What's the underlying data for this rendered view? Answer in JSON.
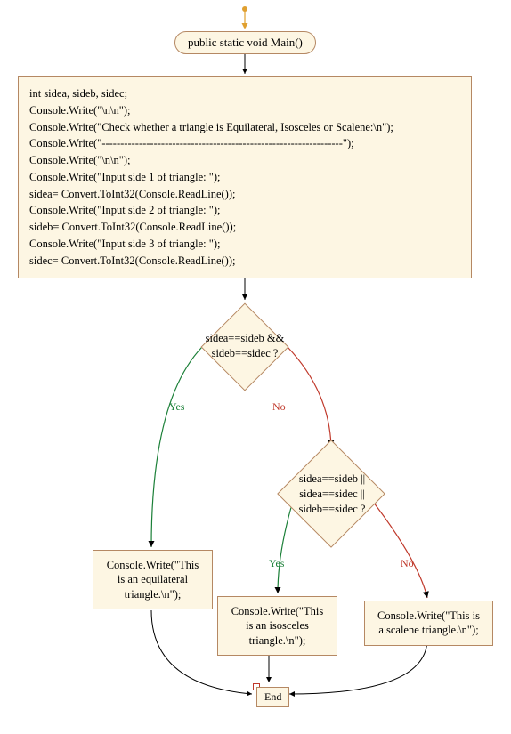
{
  "start": {
    "label": "public static void Main()"
  },
  "code_lines": [
    "int sidea, sideb, sidec;",
    "Console.Write(\"\\n\\n\");",
    "Console.Write(\"Check whether a triangle is Equilateral, Isosceles or Scalene:\\n\");",
    "Console.Write(\"-----------------------------------------------------------------\");",
    "Console.Write(\"\\n\\n\");",
    "Console.Write(\"Input side 1 of triangle: \");",
    "sidea= Convert.ToInt32(Console.ReadLine());",
    "Console.Write(\"Input side 2 of triangle: \");",
    "sideb= Convert.ToInt32(Console.ReadLine());",
    "Console.Write(\"Input side 3 of triangle: \");",
    "sidec= Convert.ToInt32(Console.ReadLine());"
  ],
  "decision1_lines": [
    "sidea==sideb &&",
    "sideb==sidec ?"
  ],
  "decision2_lines": [
    "sidea==sideb ||",
    "sidea==sidec ||",
    "sideb==sidec ?"
  ],
  "out_equilateral": "Console.Write(\"This is an equilateral triangle.\\n\");",
  "out_isosceles": "Console.Write(\"This is an isosceles triangle.\\n\");",
  "out_scalene": "Console.Write(\"This is a scalene triangle.\\n\");",
  "end": {
    "label": "End"
  },
  "labels": {
    "yes": "Yes",
    "no": "No"
  }
}
